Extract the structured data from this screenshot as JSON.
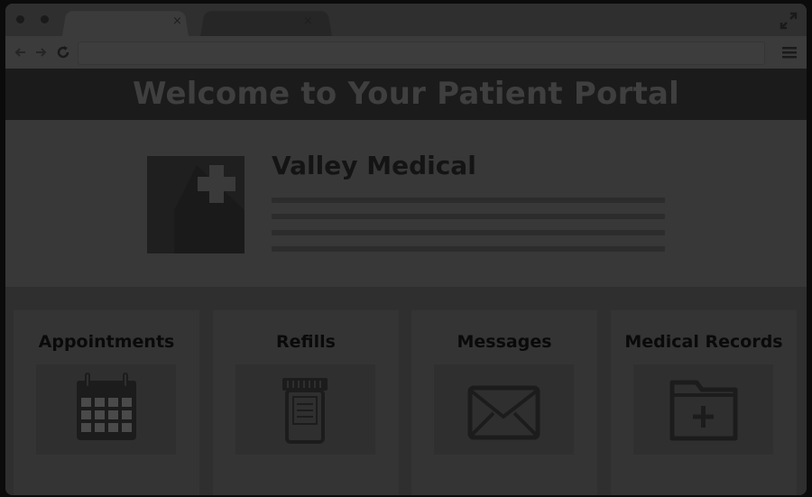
{
  "browser": {
    "tabs": [
      {
        "label": "",
        "close": "×"
      },
      {
        "label": "",
        "close": "×"
      }
    ],
    "address": ""
  },
  "banner": {
    "title": "Welcome to Your Patient Portal"
  },
  "clinic": {
    "name": "Valley Medical"
  },
  "services": [
    {
      "label": "Appointments",
      "icon": "calendar-icon"
    },
    {
      "label": "Refills",
      "icon": "pill-bottle-icon"
    },
    {
      "label": "Messages",
      "icon": "envelope-icon"
    },
    {
      "label": "Medical Records",
      "icon": "folder-add-icon"
    }
  ]
}
